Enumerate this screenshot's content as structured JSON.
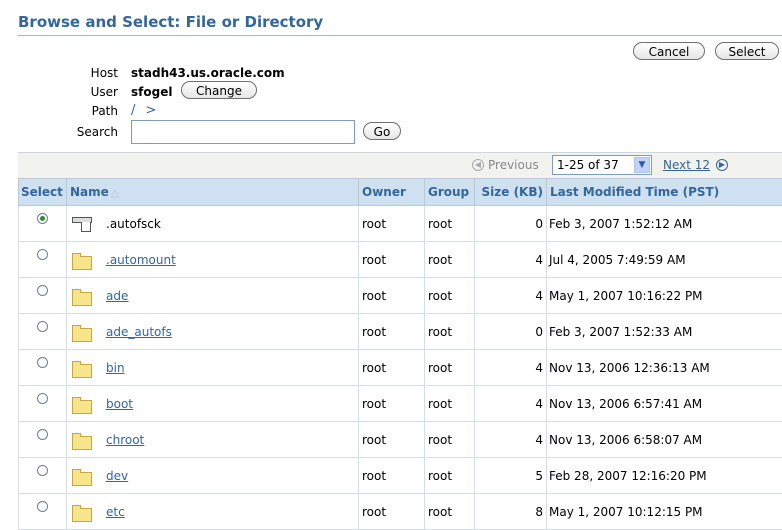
{
  "dialog": {
    "title": "Browse and Select: File or Directory",
    "cancel_label": "Cancel",
    "select_label": "Select"
  },
  "form": {
    "host_label": "Host",
    "host_value": "stadh43.us.oracle.com",
    "user_label": "User",
    "user_value": "sfogel",
    "change_label": "Change",
    "path_label": "Path",
    "path_root": "/",
    "path_sep": ">",
    "search_label": "Search",
    "search_value": "",
    "go_label": "Go"
  },
  "pagination": {
    "previous_label": "Previous",
    "range_value": "1-25 of 37",
    "next_label": "Next 12"
  },
  "table": {
    "headers": {
      "select": "Select",
      "name": "Name",
      "owner": "Owner",
      "group": "Group",
      "size": "Size (KB)",
      "modified": "Last Modified Time (PST)"
    },
    "rows": [
      {
        "name": ".autofsck",
        "type": "file",
        "selected": true,
        "owner": "root",
        "group": "root",
        "size": "0",
        "modified": "Feb 3, 2007 1:52:12 AM"
      },
      {
        "name": ".automount",
        "type": "folder",
        "selected": false,
        "owner": "root",
        "group": "root",
        "size": "4",
        "modified": "Jul 4, 2005 7:49:59 AM"
      },
      {
        "name": "ade",
        "type": "folder",
        "selected": false,
        "owner": "root",
        "group": "root",
        "size": "4",
        "modified": "May 1, 2007 10:16:22 PM"
      },
      {
        "name": "ade_autofs",
        "type": "folder",
        "selected": false,
        "owner": "root",
        "group": "root",
        "size": "0",
        "modified": "Feb 3, 2007 1:52:33 AM"
      },
      {
        "name": "bin",
        "type": "folder",
        "selected": false,
        "owner": "root",
        "group": "root",
        "size": "4",
        "modified": "Nov 13, 2006 12:36:13 AM"
      },
      {
        "name": "boot",
        "type": "folder",
        "selected": false,
        "owner": "root",
        "group": "root",
        "size": "4",
        "modified": "Nov 13, 2006 6:57:41 AM"
      },
      {
        "name": "chroot",
        "type": "folder",
        "selected": false,
        "owner": "root",
        "group": "root",
        "size": "4",
        "modified": "Nov 13, 2006 6:58:07 AM"
      },
      {
        "name": "dev",
        "type": "folder",
        "selected": false,
        "owner": "root",
        "group": "root",
        "size": "5",
        "modified": "Feb 28, 2007 12:16:20 PM"
      },
      {
        "name": "etc",
        "type": "folder",
        "selected": false,
        "owner": "root",
        "group": "root",
        "size": "8",
        "modified": "May 1, 2007 10:12:15 PM"
      }
    ]
  },
  "colors": {
    "title": "#336699",
    "header_bg": "#cfe0f1",
    "link": "#336699"
  }
}
